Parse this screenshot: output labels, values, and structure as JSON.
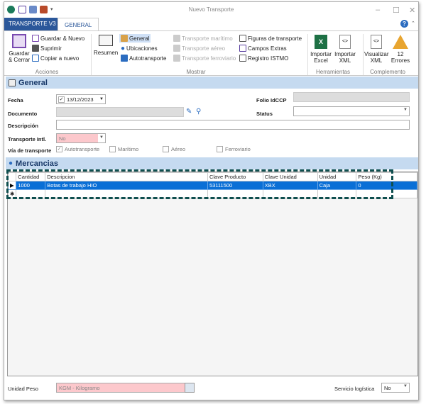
{
  "window": {
    "title": "Nuevo Transporte"
  },
  "tabs": [
    {
      "label": "TRANSPORTE V3"
    },
    {
      "label": "GENERAL"
    }
  ],
  "ribbon": {
    "acciones": {
      "group": "Acciones",
      "guardar_cerrar": "Guardar & Cerrar",
      "guardar_nuevo": "Guardar & Nuevo",
      "suprimir": "Suprimir",
      "copiar": "Copiar a nuevo"
    },
    "mostrar": {
      "group": "Mostrar",
      "resumen": "Resumen",
      "general": "General",
      "ubicaciones": "Ubicaciones",
      "autotransporte": "Autotransporte",
      "maritimo": "Transporte marítimo",
      "aereo": "Transporte aéreo",
      "ferroviario": "Transporte ferroviario",
      "figuras": "Figuras de transporte",
      "campos": "Campos Extras",
      "istmo": "Registro ISTMO"
    },
    "herramientas": {
      "group": "Herramientas",
      "importar_excel": "Importar Excel",
      "importar_xml": "Importar XML"
    },
    "complemento": {
      "group": "Complemento",
      "visualizar": "Visualizar XML",
      "errores": "12 Errores"
    }
  },
  "general": {
    "title": "General",
    "fecha_label": "Fecha",
    "fecha": "13/12/2023",
    "documento_label": "Documento",
    "documento": "",
    "descripcion_label": "Descripción",
    "descripcion": "",
    "transporte_label": "Transporte Intl.",
    "transporte": "No",
    "via_label": "Vía de transporte",
    "vias": [
      {
        "label": "Autotransporte",
        "checked": true
      },
      {
        "label": "Marítimo",
        "checked": false
      },
      {
        "label": "Aéreo",
        "checked": false
      },
      {
        "label": "Ferroviario",
        "checked": false
      }
    ],
    "folio_label": "Folio IdCCP",
    "folio": "",
    "status_label": "Status",
    "status": ""
  },
  "mercancias": {
    "title": "Mercancias",
    "columns": [
      "Cantidad",
      "Descripcion",
      "Clave Producto",
      "Clave Unidad",
      "Unidad",
      "Peso (Kg)"
    ],
    "rows": [
      [
        "1000",
        "Botas de trabajo HIO",
        "53111500",
        "XBX",
        "Caja",
        "0"
      ]
    ]
  },
  "footer": {
    "unidad_label": "Unidad Peso",
    "unidad": "KGM - Kilogramo",
    "servicio_label": "Servicio logística",
    "servicio": "No"
  }
}
